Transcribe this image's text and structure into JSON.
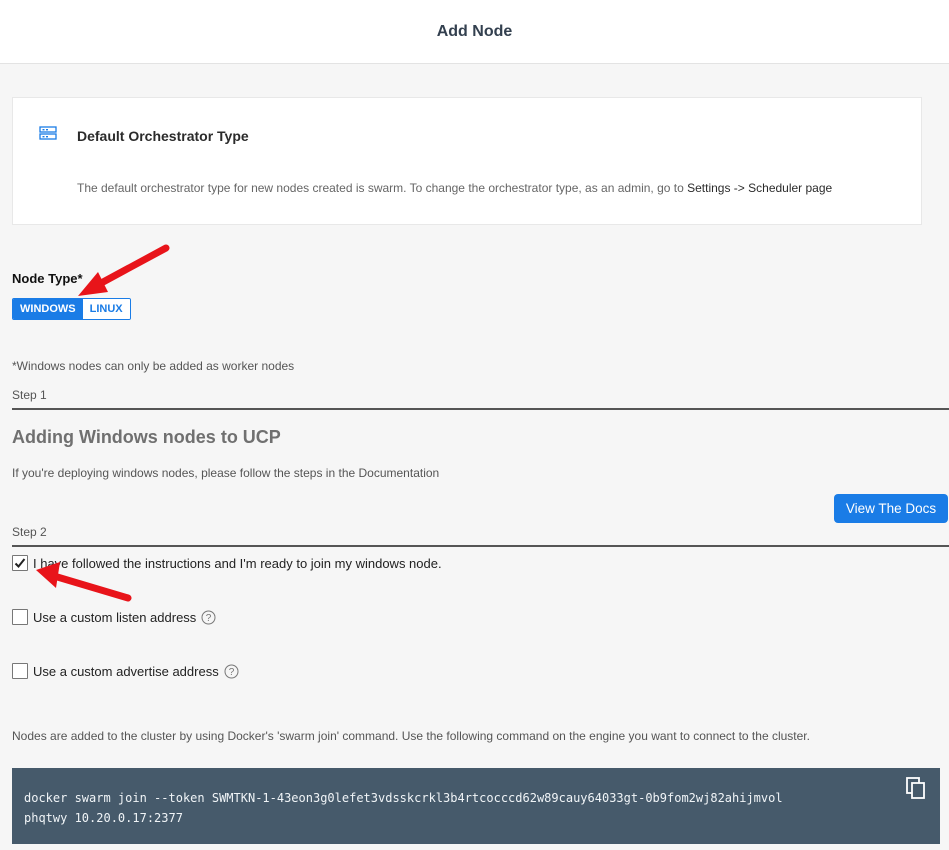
{
  "header": {
    "title": "Add Node"
  },
  "orchestrator": {
    "icon": "server-grid-icon",
    "title": "Default Orchestrator Type",
    "description_prefix": "The default orchestrator type for new nodes created is swarm. To change the orchestrator type, as an admin, go to ",
    "description_link": "Settings -> Scheduler page"
  },
  "node_type": {
    "label": "Node Type*",
    "options": [
      "WINDOWS",
      "LINUX"
    ],
    "selected": "WINDOWS"
  },
  "windows_note": "*Windows nodes can only be added as worker nodes",
  "step1": {
    "label": "Step 1",
    "title": "Adding Windows nodes to UCP",
    "description": "If you're deploying windows nodes, please follow the steps in the Documentation",
    "docs_button": "View The Docs"
  },
  "step2": {
    "label": "Step 2",
    "checkboxes": [
      {
        "label": "I have followed the instructions and I'm ready to join my windows node.",
        "checked": true
      },
      {
        "label": "Use a custom listen address",
        "checked": false,
        "help": true
      },
      {
        "label": "Use a custom advertise address",
        "checked": false,
        "help": true
      }
    ]
  },
  "command": {
    "description": "Nodes are added to the cluster by using Docker's 'swarm join' command. Use the following command on the engine you want to connect to the cluster.",
    "text": "docker swarm join --token SWMTKN-1-43eon3g0lefet3vdsskcrkl3b4rtcocccd62w89cauy64033gt-0b9fom2wj82ahijmvolphqtwy 10.20.0.17:2377",
    "copy_icon": "copy-icon"
  },
  "colors": {
    "accent": "#1a7ce6",
    "command_bg": "#465a6b",
    "annotation_arrow": "#e8141a"
  }
}
